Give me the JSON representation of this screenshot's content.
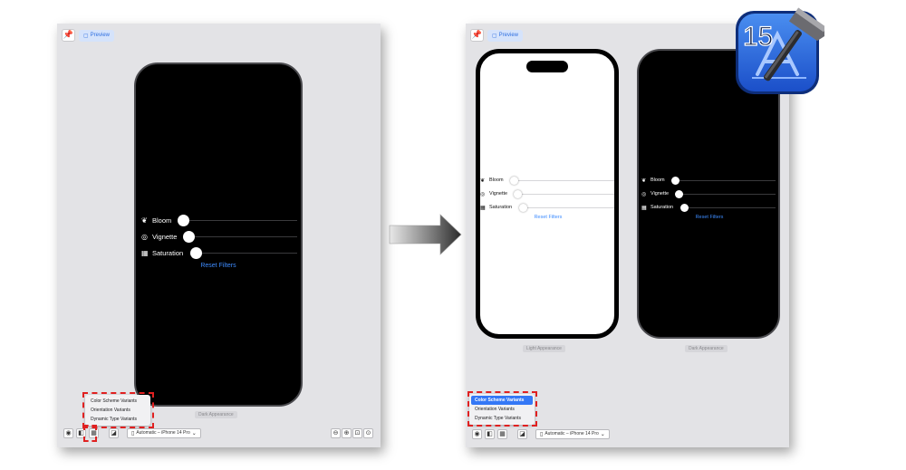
{
  "canvas_left": {
    "pin_label": "📌",
    "preview_label": "Preview",
    "controls": [
      {
        "icon": "❦",
        "label": "Bloom",
        "value": 0.0
      },
      {
        "icon": "◎",
        "label": "Vignette",
        "value": 0.0
      },
      {
        "icon": "▦",
        "label": "Saturation",
        "value": 0.0
      }
    ],
    "reset_label": "Reset Filters",
    "caption": "Dark Appearance",
    "device_label": "Automatic – iPhone 14 Pro",
    "menu_items": [
      "Color Scheme Variants",
      "Orientation Variants",
      "Dynamic Type Variants"
    ]
  },
  "canvas_right": {
    "pin_label": "📌",
    "preview_label": "Preview",
    "light_phone": {
      "controls": [
        {
          "icon": "❦",
          "label": "Bloom"
        },
        {
          "icon": "◎",
          "label": "Vignette"
        },
        {
          "icon": "▦",
          "label": "Saturation"
        }
      ],
      "reset_label": "Reset Filters",
      "caption": "Light Appearance"
    },
    "dark_phone": {
      "controls": [
        {
          "icon": "❦",
          "label": "Bloom"
        },
        {
          "icon": "◎",
          "label": "Vignette"
        },
        {
          "icon": "▦",
          "label": "Saturation"
        }
      ],
      "reset_label": "Reset Filters",
      "caption": "Dark Appearance"
    },
    "device_label": "Automatic – iPhone 14 Pro",
    "menu_items": [
      "Color Scheme Variants",
      "Orientation Variants",
      "Dynamic Type Variants"
    ],
    "selected_menu_item": "Color Scheme Variants"
  },
  "toolbar_icons": {
    "live": "◉",
    "selectable": "◧",
    "variants": "▦",
    "device_settings": "◪",
    "device_icon": "▯",
    "chevron": "⌄"
  },
  "zoom_icons": [
    "⊖",
    "⊕",
    "⊡",
    "⊙"
  ],
  "badge": {
    "number": "15"
  },
  "colors": {
    "accent": "#3478f6",
    "reset_link": "#3e8cff",
    "highlight_dash": "#e02020",
    "canvas_bg": "#e3e3e6"
  }
}
